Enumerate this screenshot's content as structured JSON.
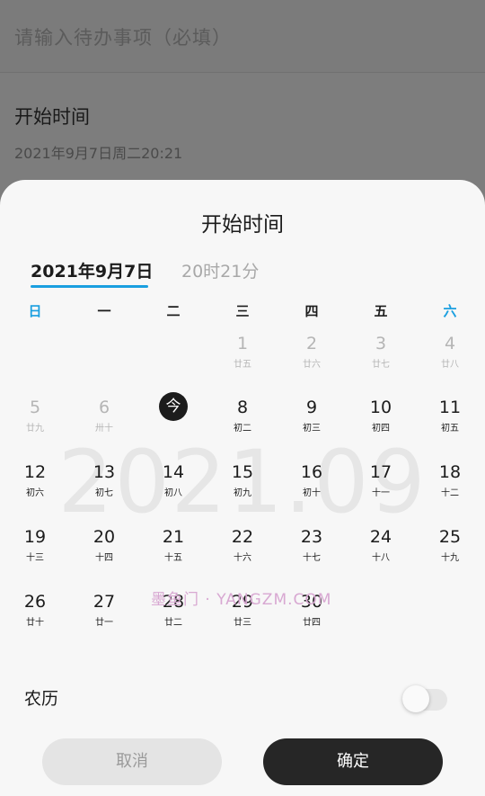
{
  "form": {
    "todo_placeholder": "请输入待办事项（必填）",
    "start_label": "开始时间",
    "start_value": "2021年9月7日周二20:21"
  },
  "picker": {
    "title": "开始时间",
    "tabs": {
      "date": "2021年9月7日",
      "time": "20时21分"
    },
    "weekdays": [
      "日",
      "一",
      "二",
      "三",
      "四",
      "五",
      "六"
    ],
    "watermark": "2021.09",
    "rows": [
      [
        null,
        null,
        null,
        {
          "num": "1",
          "lunar": "廿五",
          "muted": true
        },
        {
          "num": "2",
          "lunar": "廿六",
          "muted": true
        },
        {
          "num": "3",
          "lunar": "廿七",
          "muted": true
        },
        {
          "num": "4",
          "lunar": "廿八",
          "muted": true
        }
      ],
      [
        {
          "num": "5",
          "lunar": "廿九",
          "muted": true
        },
        {
          "num": "6",
          "lunar": "卅十",
          "muted": true
        },
        {
          "num": "今",
          "lunar": "",
          "today": true
        },
        {
          "num": "8",
          "lunar": "初二"
        },
        {
          "num": "9",
          "lunar": "初三"
        },
        {
          "num": "10",
          "lunar": "初四"
        },
        {
          "num": "11",
          "lunar": "初五"
        }
      ],
      [
        {
          "num": "12",
          "lunar": "初六"
        },
        {
          "num": "13",
          "lunar": "初七"
        },
        {
          "num": "14",
          "lunar": "初八"
        },
        {
          "num": "15",
          "lunar": "初九"
        },
        {
          "num": "16",
          "lunar": "初十"
        },
        {
          "num": "17",
          "lunar": "十一"
        },
        {
          "num": "18",
          "lunar": "十二"
        }
      ],
      [
        {
          "num": "19",
          "lunar": "十三"
        },
        {
          "num": "20",
          "lunar": "十四"
        },
        {
          "num": "21",
          "lunar": "十五"
        },
        {
          "num": "22",
          "lunar": "十六"
        },
        {
          "num": "23",
          "lunar": "十七"
        },
        {
          "num": "24",
          "lunar": "十八"
        },
        {
          "num": "25",
          "lunar": "十九"
        }
      ],
      [
        {
          "num": "26",
          "lunar": "廿十"
        },
        {
          "num": "27",
          "lunar": "廿一"
        },
        {
          "num": "28",
          "lunar": "廿二"
        },
        {
          "num": "29",
          "lunar": "廿三"
        },
        {
          "num": "30",
          "lunar": "廿四"
        },
        null,
        null
      ]
    ],
    "lunar_label": "农历",
    "lunar_toggle_on": false,
    "cancel_label": "取消",
    "confirm_label": "确定"
  },
  "site_watermark": "墨鱼门 · YANGZM.COM",
  "colors": {
    "accent": "#1a9fe0",
    "dark": "#262626"
  }
}
